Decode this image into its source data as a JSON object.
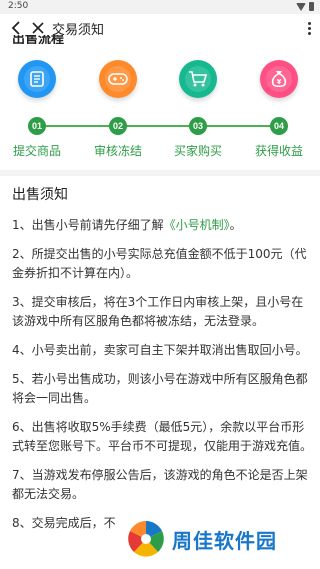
{
  "status_bar": {
    "time": "2:50"
  },
  "header": {
    "title": "交易须知"
  },
  "section_peek": "出售流程",
  "steps": [
    {
      "num": "01",
      "label": "提交商品",
      "icon": "document-icon",
      "color": "#2196f3"
    },
    {
      "num": "02",
      "label": "审核冻结",
      "icon": "gamepad-icon",
      "color": "#ff8a2b"
    },
    {
      "num": "03",
      "label": "买家购买",
      "icon": "cart-icon",
      "color": "#16b98f"
    },
    {
      "num": "04",
      "label": "获得收益",
      "icon": "money-bag-icon",
      "color": "#ff4f84"
    }
  ],
  "notice": {
    "title": "出售须知",
    "items": [
      {
        "prefix": "1、出售小号前请先仔细了解",
        "link": "《小号机制》",
        "suffix": "。"
      },
      {
        "text": "2、所提交出售的小号实际总充值金额不低于100元（代金券折扣不计算在内）。"
      },
      {
        "text": "3、提交审核后，将在3个工作日内审核上架，且小号在该游戏中所有区服角色都将被冻结，无法登录。"
      },
      {
        "text": "4、小号卖出前，卖家可自主下架并取消出售取回小号。"
      },
      {
        "text": "5、若小号出售成功，则该小号在游戏中所有区服角色都将会一同出售。"
      },
      {
        "text": "6、出售将收取5%手续费（最低5元），余款以平台币形式转至您账号下。平台币不可提现，仅能用于游戏充值。"
      },
      {
        "text": "7、当游戏发布停服公告后，该游戏的角色不论是否上架都无法交易。"
      },
      {
        "text": "8、交易完成后，不"
      }
    ]
  },
  "watermark": {
    "text": "周佳软件园"
  },
  "colors": {
    "accent": "#2e9d47"
  }
}
